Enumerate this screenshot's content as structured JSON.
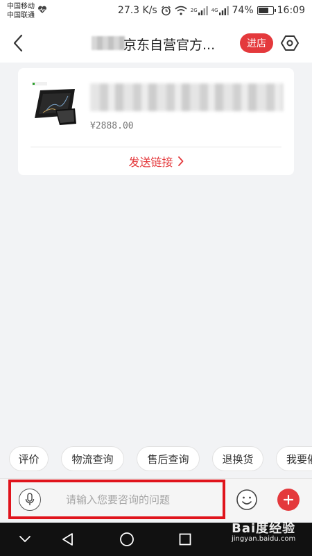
{
  "status_bar": {
    "carrier_1": "中国移动",
    "carrier_2": "中国联通",
    "network_speed": "27.3 K/s",
    "signal_1_label": "2G",
    "signal_2_label": "4G",
    "battery_percent": "74%",
    "battery_level": 0.74,
    "time": "16:09"
  },
  "header": {
    "title": "京东自营官方...",
    "enter_store_label": "进店"
  },
  "product_card": {
    "price": "¥2888.00",
    "send_link_label": "发送链接"
  },
  "quick_tags": [
    "评价",
    "物流查询",
    "售后查询",
    "退换货",
    "我要催"
  ],
  "input_bar": {
    "placeholder": "请输入您要咨询的问题"
  },
  "watermark": {
    "main": "Bai度经验",
    "sub": "jingyan.baidu.com"
  },
  "colors": {
    "accent": "#e4393c",
    "highlight_frame": "#e0141c",
    "background": "#f2f3f5"
  },
  "icons": [
    "heart-rate-icon",
    "alarm-clock-icon",
    "wifi-icon",
    "signal-icon",
    "battery-icon",
    "back-arrow-icon",
    "settings-hexagon-icon",
    "chevron-right-icon",
    "microphone-icon",
    "emoji-icon",
    "plus-icon",
    "nav-down-icon",
    "nav-back-icon",
    "nav-home-icon",
    "nav-recent-icon"
  ]
}
